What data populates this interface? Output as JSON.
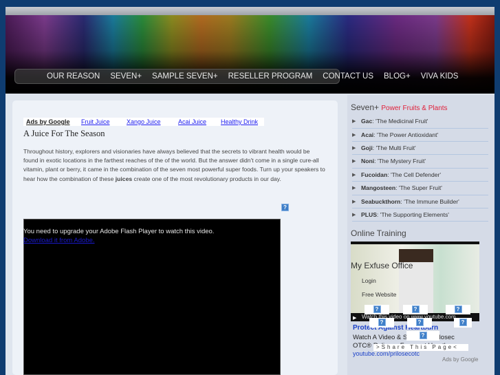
{
  "nav": {
    "items": [
      "OUR REASON",
      "SEVEN+",
      "SAMPLE SEVEN+",
      "RESELLER PROGRAM",
      "CONTACT US",
      "BLOG+",
      "VIVA KIDS"
    ]
  },
  "ads": {
    "label": "Ads by Google",
    "links": [
      "Fruit Juice",
      "Xango Juice",
      "Acai Juice",
      "Healthy Drink"
    ]
  },
  "article": {
    "title": "A Juice For The Season",
    "body_before": "Throughout history, explorers and visionaries have always believed that the secrets to vibrant health would be found in exotic locations in the farthest reaches of the of the world. But the answer didn't come in a single cure-all vitamin, plant or berry, it came in the combination of the seven most powerful super foods. Turn up your speakers to hear how the combination of these ",
    "body_bold": "juices",
    "body_after": " create one of the most revolutionary products in our day."
  },
  "flash": {
    "message": "You need to upgrade your Adobe Flash Player to watch this video.",
    "link": "Download it from Adobe."
  },
  "sidebar": {
    "title": "Seven+",
    "subtitle": "Power Fruits & Plants",
    "items": [
      {
        "name": "Gac",
        "desc": ": 'The Medicinal Fruit'"
      },
      {
        "name": "Acai",
        "desc": ": 'The Power Antioxidant'"
      },
      {
        "name": "Goji",
        "desc": ": 'The Multi Fruit'"
      },
      {
        "name": "Noni",
        "desc": ": 'The Mystery Fruit'"
      },
      {
        "name": "Fucoidan",
        "desc": ": 'The Cell Defender'"
      },
      {
        "name": "Mangosteen",
        "desc": ": 'The Super Fruit'"
      },
      {
        "name": "Seabuckthorn",
        "desc": ": 'The Immune Builder'"
      },
      {
        "name": "PLUS",
        "desc": ": 'The Supporting Elements'"
      }
    ],
    "training_title": "Online Training",
    "video_caption": "Watch this video on www.youtube.com",
    "office": "My Exfuse Office",
    "login": "Login",
    "free_website": "Free Website",
    "ad_title": "Protect Against Heartburn",
    "ad_line1": "Watch A Video & See How Prilosec",
    "ad_line2": "OTC® Relieves Frequent Heartburn",
    "ad_url": "youtube.com/prilosecotc",
    "share": ">Share This Page<",
    "ads_by": "Ads by Google"
  },
  "colors": {
    "background": "#0f3c70",
    "accent": "#e0203a",
    "link": "#1a1aee"
  }
}
